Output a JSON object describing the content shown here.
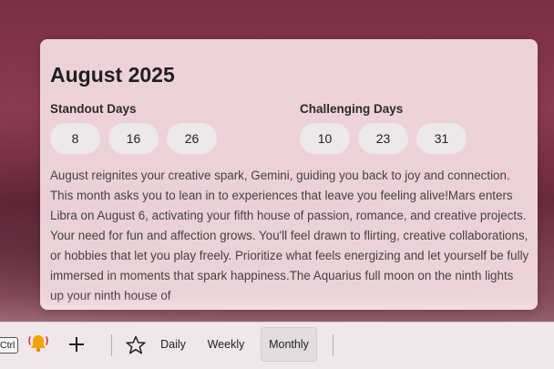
{
  "card": {
    "title": "August 2025",
    "standout": {
      "label": "Standout Days",
      "days": [
        "8",
        "16",
        "26"
      ]
    },
    "challenging": {
      "label": "Challenging Days",
      "days": [
        "10",
        "23",
        "31"
      ]
    },
    "body": "August reignites your creative spark, Gemini, guiding you back to joy and connection. This month asks you to lean in to experiences that leave you feeling alive!Mars enters Libra on August 6, activating your fifth house of passion, romance, and creative projects. Your need for fun and affection grows. You'll feel drawn to flirting, creative collaborations, or hobbies that let you play freely. Prioritize what feels energizing and let yourself be fully immersed in moments that spark happiness.The Aquarius full moon on the ninth lights up your ninth house of"
  },
  "taskbar": {
    "ctrl_label": "Ctrl",
    "tabs": [
      {
        "label": "Daily",
        "selected": false
      },
      {
        "label": "Weekly",
        "selected": false
      },
      {
        "label": "Monthly",
        "selected": true
      }
    ],
    "icons": {
      "bell": "bell-icon",
      "plus": "plus-icon",
      "star": "star-icon"
    },
    "colors": {
      "bell": "#f2a500",
      "bell_waves": "#e0392b"
    }
  }
}
